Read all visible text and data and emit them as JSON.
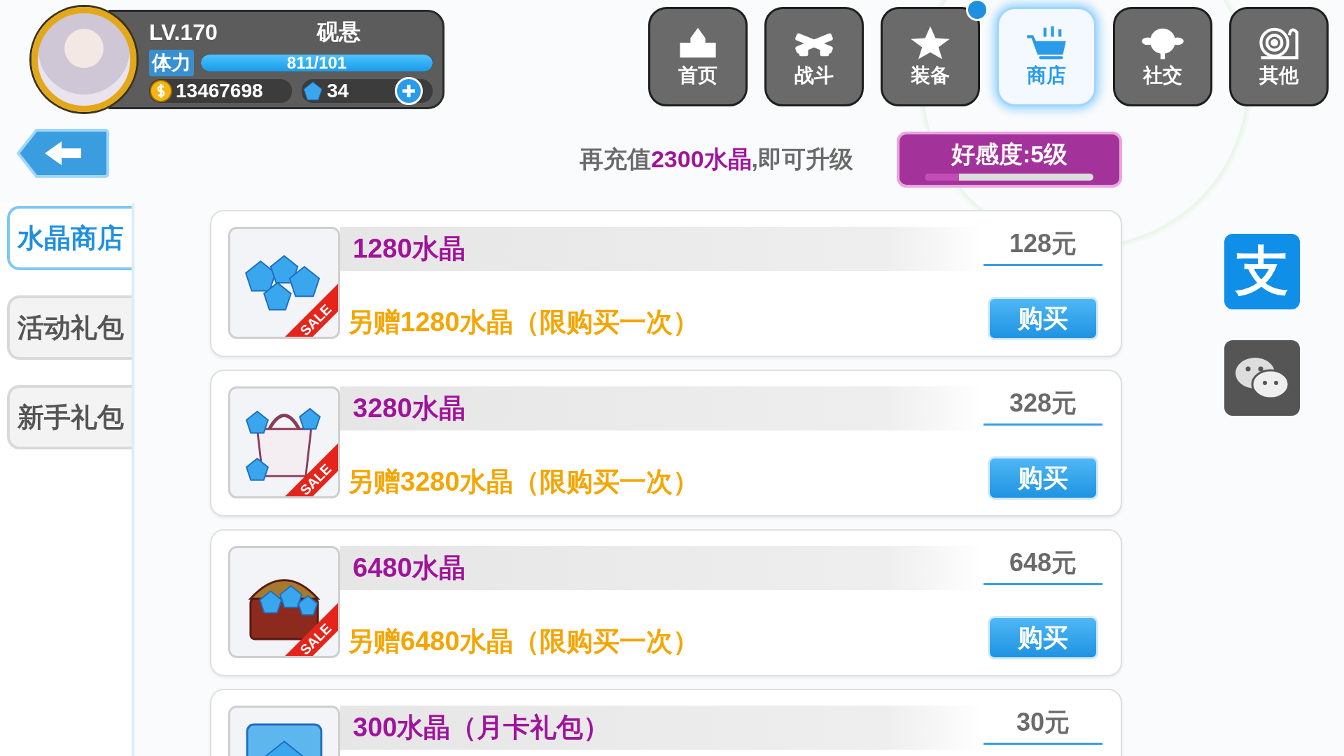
{
  "player": {
    "level": "LV.170",
    "name": "砚悬",
    "stamina_label": "体力",
    "stamina": {
      "reading": "811/101",
      "level": 1
    },
    "gold": "13467698",
    "gems": "34"
  },
  "nav": [
    {
      "label": "首页",
      "kind": "home",
      "selected": false,
      "notification": false
    },
    {
      "label": "战斗",
      "kind": "battle",
      "selected": false,
      "notification": false
    },
    {
      "label": "装备",
      "kind": "equip",
      "selected": false,
      "notification": true
    },
    {
      "label": "商店",
      "kind": "shop",
      "selected": true,
      "notification": false
    },
    {
      "label": "社交",
      "kind": "social",
      "selected": false,
      "notification": false
    },
    {
      "label": "其他",
      "kind": "other",
      "selected": false,
      "notification": false
    }
  ],
  "sidebar": [
    {
      "label": "水晶商店",
      "selected": true
    },
    {
      "label": "活动礼包",
      "selected": false
    },
    {
      "label": "新手礼包",
      "selected": false
    }
  ],
  "promo": "再充值**2300水晶**,即可升级",
  "affection": {
    "label": "好感度:5级",
    "level": 0.2
  },
  "products": [
    {
      "title": "1280水晶",
      "kind": "gems",
      "badge": "SALE",
      "bonus": "另赠1280水晶（限购买一次）",
      "price": "128元",
      "button": "购买"
    },
    {
      "title": "3280水晶",
      "kind": "bag",
      "badge": "SALE",
      "bonus": "另赠3280水晶（限购买一次）",
      "price": "328元",
      "button": "购买"
    },
    {
      "title": "6480水晶",
      "kind": "chest",
      "badge": "SALE",
      "bonus": "另赠6480水晶（限购买一次）",
      "price": "648元",
      "button": "购买"
    },
    {
      "title": "300水晶（月卡礼包）",
      "kind": "card",
      "price": "30元"
    }
  ],
  "payment_methods": [
    {
      "kind": "alipay",
      "label": "支"
    },
    {
      "kind": "wechat"
    }
  ]
}
